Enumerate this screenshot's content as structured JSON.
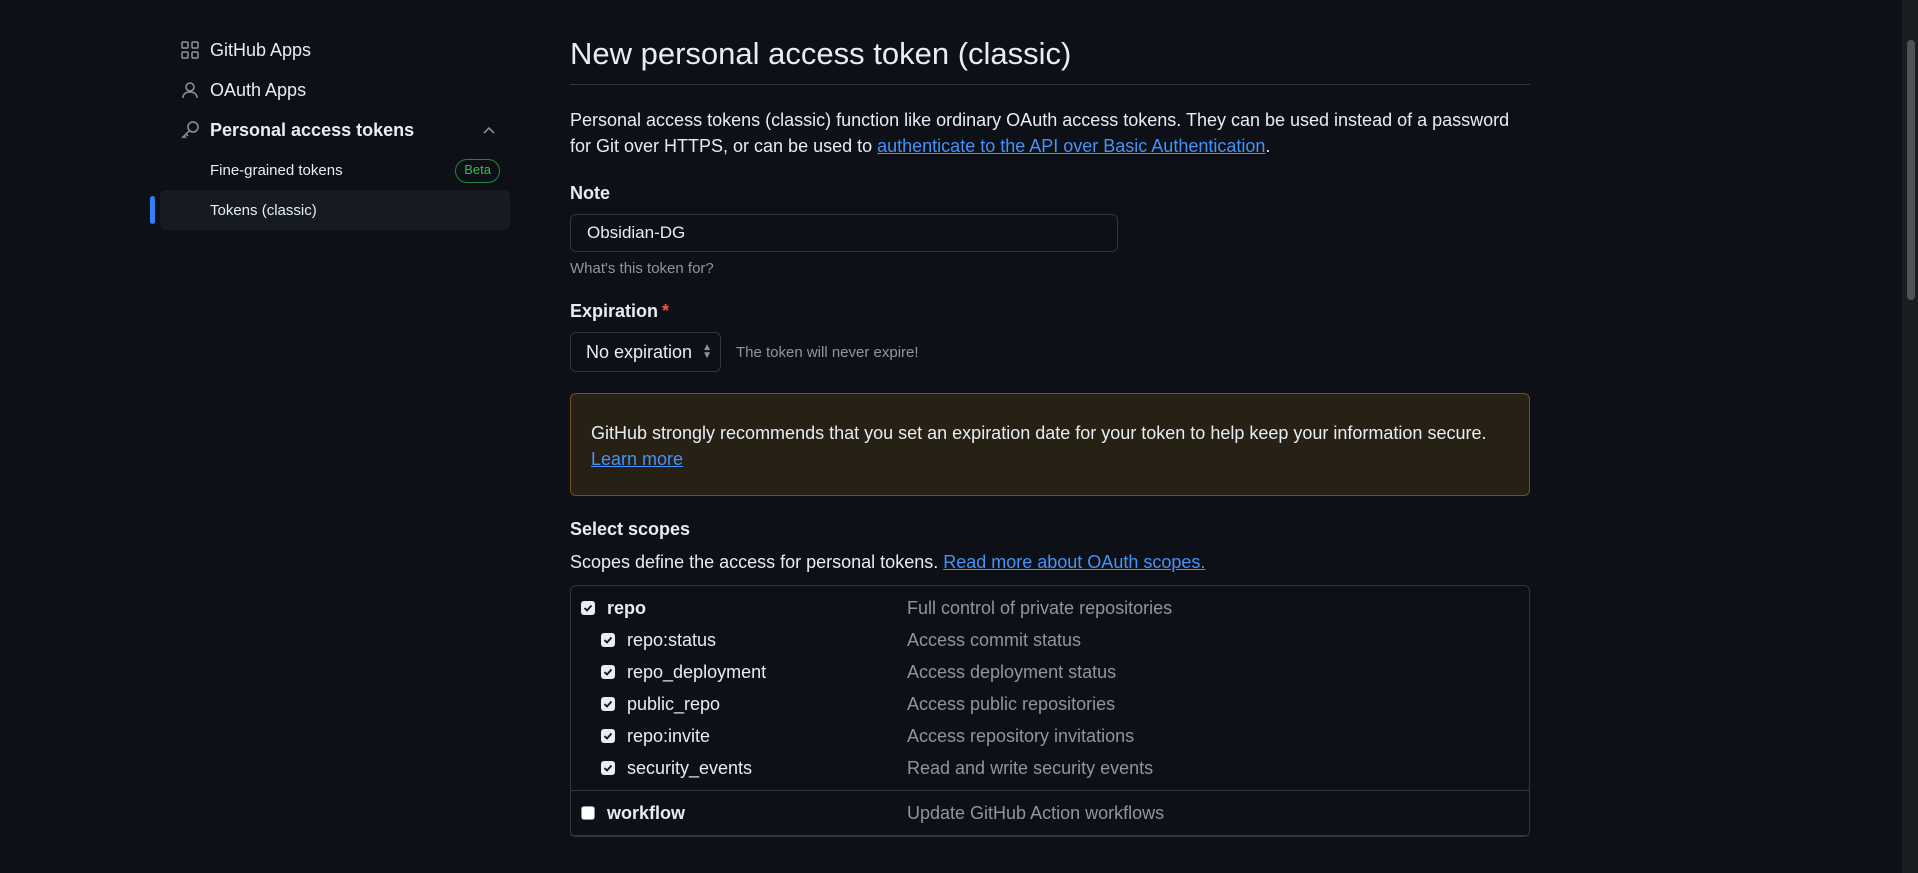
{
  "sidebar": {
    "items": [
      {
        "label": "GitHub Apps",
        "icon": "apps-grid-icon"
      },
      {
        "label": "OAuth Apps",
        "icon": "person-icon"
      },
      {
        "label": "Personal access tokens",
        "icon": "key-icon"
      }
    ],
    "sub_items": [
      {
        "label": "Fine-grained tokens",
        "badge": "Beta"
      },
      {
        "label": "Tokens (classic)"
      }
    ]
  },
  "main": {
    "title": "New personal access token (classic)",
    "intro_text": "Personal access tokens (classic) function like ordinary OAuth access tokens. They can be used instead of a password for Git over HTTPS, or can be used to ",
    "intro_link": "authenticate to the API over Basic Authentication",
    "intro_end": ".",
    "note": {
      "label": "Note",
      "value": "Obsidian-DG",
      "hint": "What's this token for?"
    },
    "expiration": {
      "label": "Expiration",
      "required_mark": "*",
      "selected": "No expiration",
      "hint": "The token will never expire!"
    },
    "warning": {
      "text": "GitHub strongly recommends that you set an expiration date for your token to help keep your information secure.",
      "link": "Learn more"
    },
    "scopes": {
      "title": "Select scopes",
      "description": "Scopes define the access for personal tokens. ",
      "link": "Read more about OAuth scopes.",
      "groups": [
        {
          "parent": {
            "name": "repo",
            "desc": "Full control of private repositories",
            "checked": true
          },
          "children": [
            {
              "name": "repo:status",
              "desc": "Access commit status",
              "checked": true
            },
            {
              "name": "repo_deployment",
              "desc": "Access deployment status",
              "checked": true
            },
            {
              "name": "public_repo",
              "desc": "Access public repositories",
              "checked": true
            },
            {
              "name": "repo:invite",
              "desc": "Access repository invitations",
              "checked": true
            },
            {
              "name": "security_events",
              "desc": "Read and write security events",
              "checked": true
            }
          ]
        },
        {
          "parent": {
            "name": "workflow",
            "desc": "Update GitHub Action workflows",
            "checked": false
          },
          "children": []
        }
      ]
    }
  },
  "colors": {
    "background": "#0d1117",
    "accent": "#2f81f7",
    "link": "#4493f8",
    "warning_bg": "#272115",
    "badge_green": "#3fb950"
  }
}
